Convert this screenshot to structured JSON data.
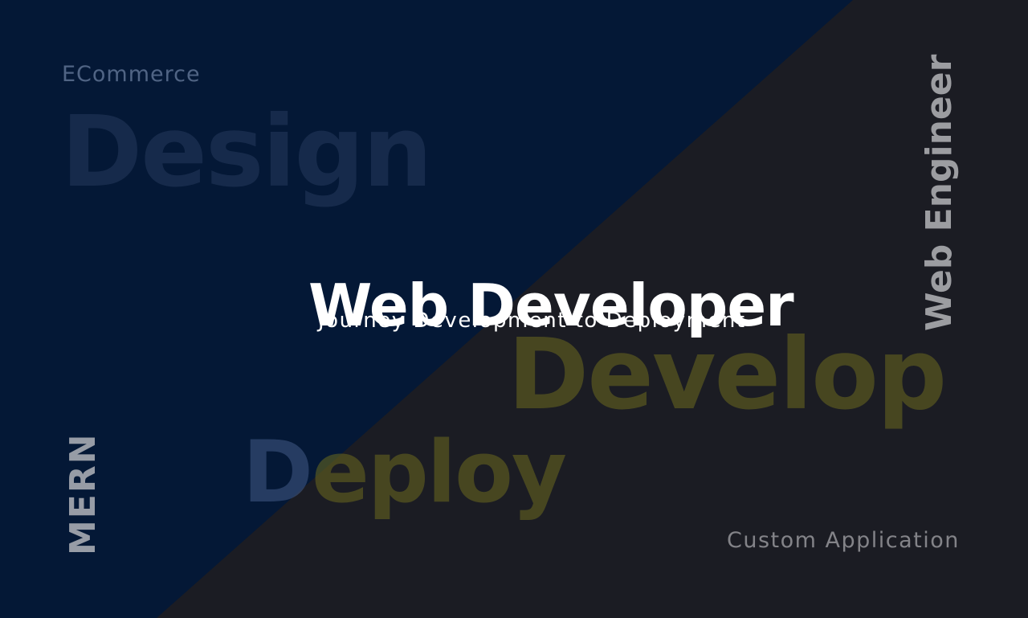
{
  "colors": {
    "navy": "#041836",
    "charcoal": "#1b1c23",
    "white": "#ffffff",
    "muted_blue": "#8fa3c4",
    "design_blue": "#3a4e72",
    "olive": "#6b6a1e",
    "deploy_d_blue": "#3d5580",
    "grey_text": "#c8c8cc"
  },
  "headline": "Web Developer",
  "tagline": "Journey Development to Deployment",
  "words": {
    "ecommerce": "ECommerce",
    "design": "Design",
    "develop": "Develop",
    "deploy_first": "D",
    "deploy_rest": "eploy",
    "web_engineer": "Web Engineer",
    "mern": "MERN",
    "custom_application": "Custom Application"
  }
}
